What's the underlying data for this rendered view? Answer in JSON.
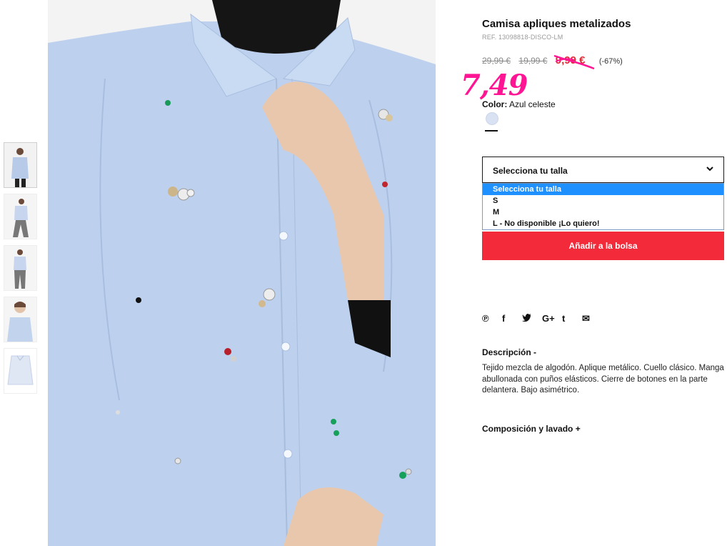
{
  "product": {
    "title": "Camisa apliques metalizados",
    "ref": "REF. 13098818-DISCO-LM",
    "price_original": "29,99 €",
    "price_previous": "19,99 €",
    "price_current": "9,99 €",
    "discount": "(-67%)",
    "handwritten_price": "7,49",
    "color_label": "Color:",
    "color_value": "Azul celeste"
  },
  "size_select": {
    "selected": "Selecciona tu talla",
    "options": [
      "Selecciona tu talla",
      "S",
      "M",
      "L - No disponible ¡Lo quiero!"
    ]
  },
  "add_button": "Añadir a la bolsa",
  "social_icons": [
    "pinterest-icon",
    "facebook-icon",
    "twitter-icon",
    "google-plus-icon",
    "tumblr-icon",
    "mail-icon"
  ],
  "social_glyphs": {
    "pinterest": "℗",
    "facebook": "f",
    "twitter": "🐦",
    "gplus": "G+",
    "tumblr": "t",
    "mail": "✉"
  },
  "description": {
    "heading": "Descripción -",
    "text": "Tejido mezcla de algodón. Aplique metálico. Cuello clásico. Manga abullonada con puños elásticos. Cierre de botones en la parte delantera. Bajo asimétrico."
  },
  "composition_heading": "Composición y lavado +",
  "colors": {
    "accent": "#f22a3a",
    "sale": "#e02b35",
    "handwritten": "#ff1493",
    "shirt": "#bcd0ec"
  }
}
